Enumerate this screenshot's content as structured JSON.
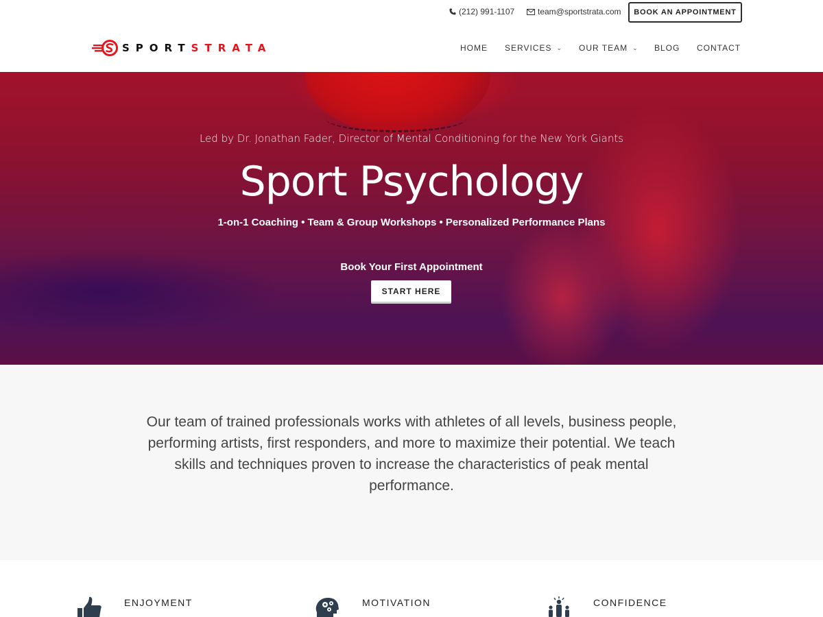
{
  "topbar": {
    "phone": "(212) 991-1107",
    "email": "team@sportstrata.com",
    "book_label": "BOOK AN APPOINTMENT"
  },
  "logo": {
    "part1": "SPORT",
    "part2": "STRATA"
  },
  "nav": {
    "items": [
      {
        "label": "HOME"
      },
      {
        "label": "SERVICES"
      },
      {
        "label": "OUR TEAM"
      },
      {
        "label": "BLOG"
      },
      {
        "label": "CONTACT"
      }
    ]
  },
  "hero": {
    "subtitle": "Led by Dr. Jonathan Fader, Director of Mental Conditioning for the New York Giants",
    "title": "Sport Psychology",
    "features": "1-on-1 Coaching • Team & Group Workshops • Personalized Performance Plans",
    "cta_label": "Book Your First Appointment",
    "cta_button": "START HERE"
  },
  "intro": {
    "text": "Our team of trained professionals works with athletes of all levels, business people, performing artists, first responders, and more to maximize their potential. We teach skills and techniques proven to increase the characteristics of peak mental performance."
  },
  "features": [
    {
      "label": "ENJOYMENT",
      "icon": "thumbs-up-icon"
    },
    {
      "label": "MOTIVATION",
      "icon": "head-gears-icon"
    },
    {
      "label": "CONFIDENCE",
      "icon": "team-people-icon"
    }
  ],
  "colors": {
    "brand_red": "#e8131b",
    "hero_overlay": "#8b1230",
    "text_dark": "#333333"
  }
}
